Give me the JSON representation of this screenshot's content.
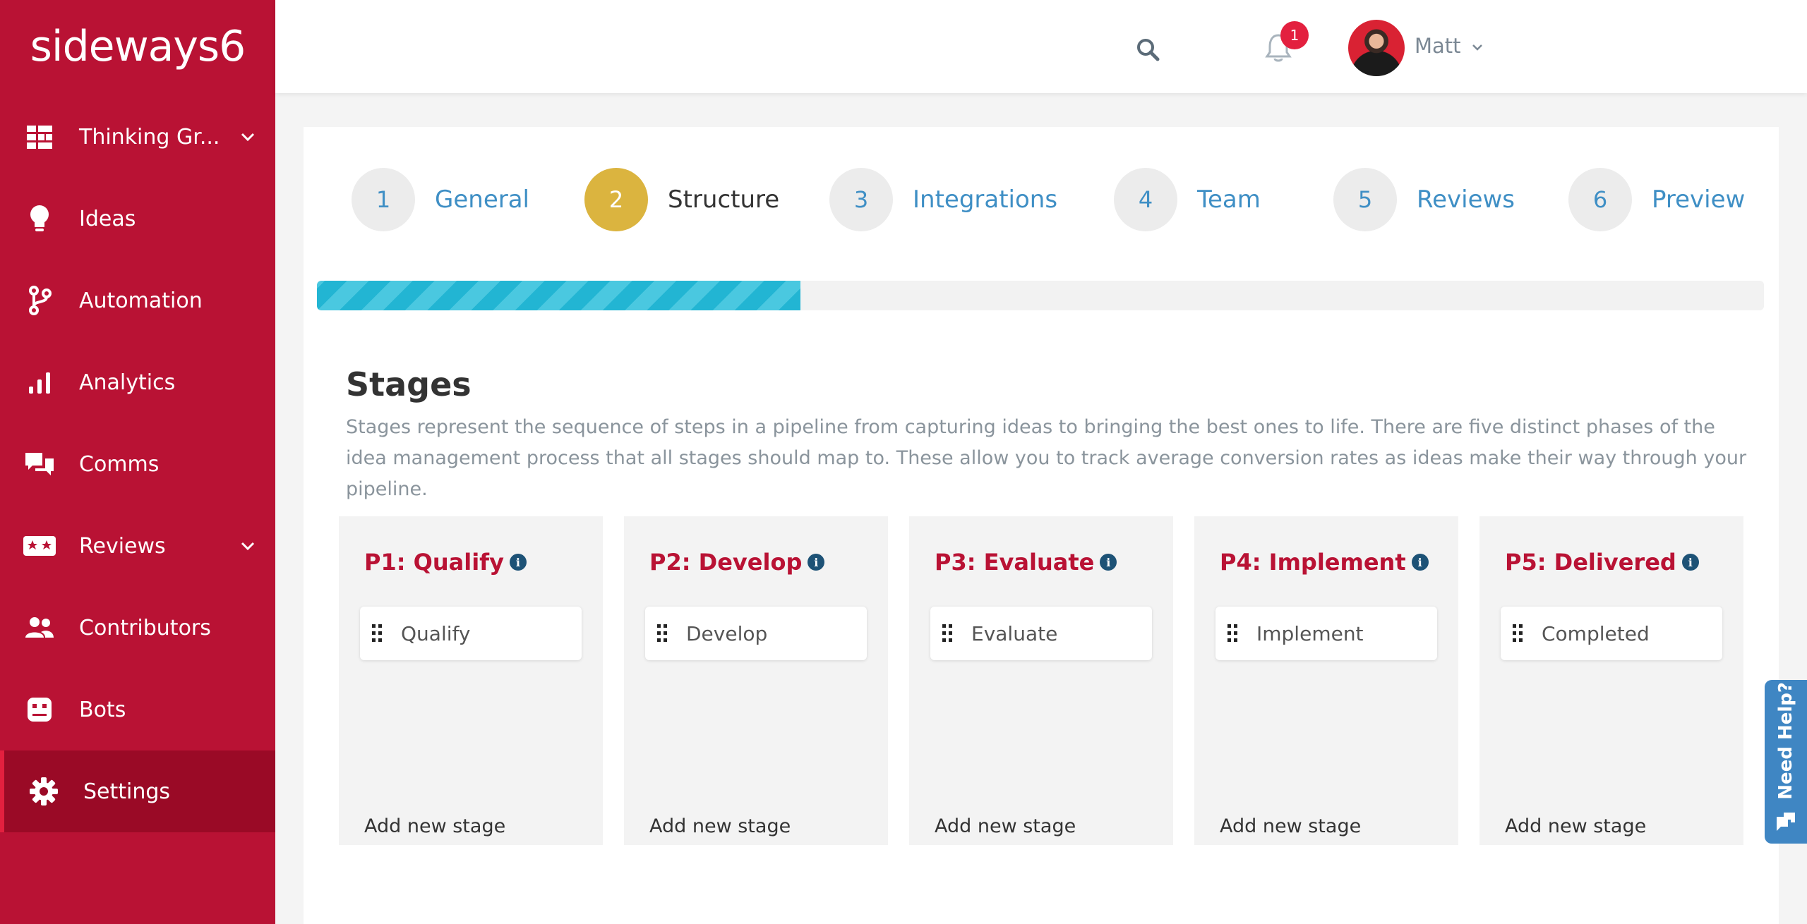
{
  "app": {
    "logo_text": "sideways6"
  },
  "sidebar": {
    "items": [
      {
        "label": "Thinking Gr...",
        "icon": "grid-icon",
        "has_chevron": true
      },
      {
        "label": "Ideas",
        "icon": "lightbulb-icon"
      },
      {
        "label": "Automation",
        "icon": "branch-icon"
      },
      {
        "label": "Analytics",
        "icon": "bar-chart-icon"
      },
      {
        "label": "Comms",
        "icon": "chat-icon"
      },
      {
        "label": "Reviews",
        "icon": "ticket-icon",
        "has_chevron": true
      },
      {
        "label": "Contributors",
        "icon": "users-icon"
      },
      {
        "label": "Bots",
        "icon": "robot-icon"
      },
      {
        "label": "Settings",
        "icon": "gear-icon",
        "active": true
      }
    ]
  },
  "topbar": {
    "notification_count": "1",
    "user_name": "Matt"
  },
  "wizard": {
    "steps": [
      {
        "number": "1",
        "label": "General"
      },
      {
        "number": "2",
        "label": "Structure",
        "active": true
      },
      {
        "number": "3",
        "label": "Integrations"
      },
      {
        "number": "4",
        "label": "Team"
      },
      {
        "number": "5",
        "label": "Reviews"
      },
      {
        "number": "6",
        "label": "Preview"
      }
    ],
    "progress_fraction": 0.334
  },
  "stages": {
    "title": "Stages",
    "description": "Stages represent the sequence of steps in a pipeline from capturing ideas to bringing the best ones to life. There are five distinct phases of the idea management process that all stages should map to. These allow you to track average conversion rates as ideas make their way through your pipeline.",
    "phases": [
      {
        "title": "P1: Qualify",
        "stage": "Qualify",
        "add_label": "Add new stage"
      },
      {
        "title": "P2: Develop",
        "stage": "Develop",
        "add_label": "Add new stage"
      },
      {
        "title": "P3: Evaluate",
        "stage": "Evaluate",
        "add_label": "Add new stage"
      },
      {
        "title": "P4: Implement",
        "stage": "Implement",
        "add_label": "Add new stage"
      },
      {
        "title": "P5: Delivered",
        "stage": "Completed",
        "add_label": "Add new stage"
      }
    ]
  },
  "help": {
    "label": "Need Help?"
  },
  "colors": {
    "brand": "#b91234",
    "brand_dark": "#9a0a26",
    "step_active": "#dbb43f",
    "link_blue": "#3f8fc5",
    "progress": "#22b5d3",
    "info_icon": "#1d5276",
    "help_tab": "#3f86c3",
    "badge": "#e3203f"
  }
}
